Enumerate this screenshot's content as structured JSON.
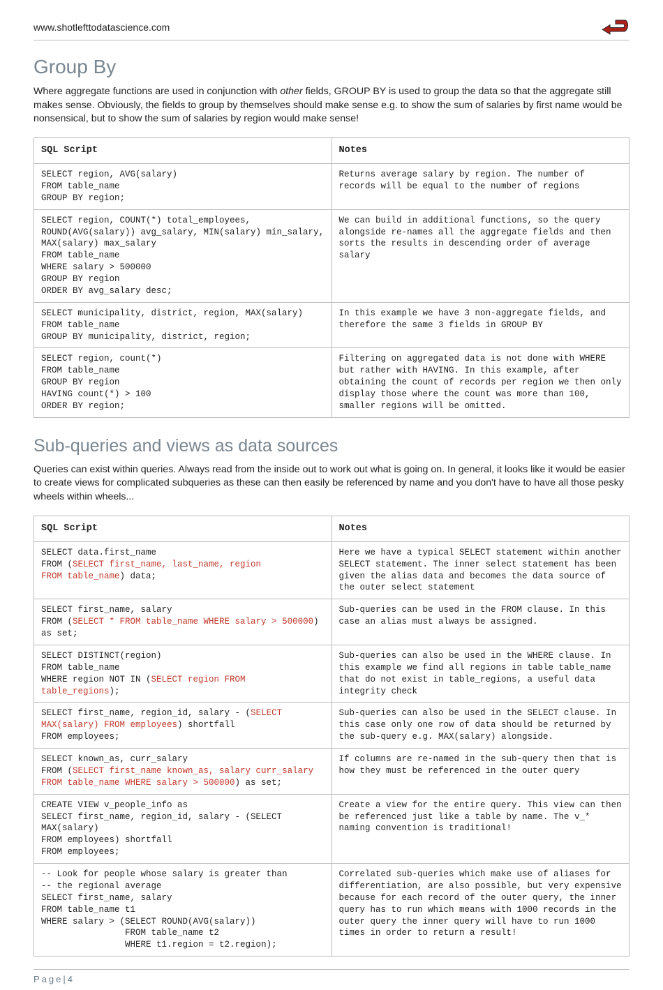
{
  "header": {
    "url": "www.shotlefttodatascience.com"
  },
  "section1": {
    "title": "Group By",
    "intro_pre": "Where aggregate functions are used in conjunction with ",
    "intro_em": "other",
    "intro_post": " fields, GROUP BY is used to group the data so that the aggregate still makes sense. Obviously, the fields to group by themselves should make sense e.g. to show the sum of salaries by first name would be nonsensical, but to show the sum of salaries by region would make sense!",
    "th1": "SQL Script",
    "th2": "Notes",
    "rows": [
      {
        "script": "SELECT region, AVG(salary)\nFROM table_name\nGROUP BY region;",
        "notes": "Returns average salary by region. The number of records will be equal to the number of regions"
      },
      {
        "script": "SELECT region, COUNT(*) total_employees, ROUND(AVG(salary)) avg_salary, MIN(salary) min_salary, MAX(salary) max_salary\nFROM table_name\nWHERE salary > 500000\nGROUP BY region\nORDER BY avg_salary desc;",
        "notes": "We can build in additional functions, so the query alongside re-names all the aggregate fields and then sorts the results in descending order of average salary"
      },
      {
        "script": "SELECT municipality, district, region, MAX(salary)\nFROM table_name\nGROUP BY municipality, district, region;",
        "notes": "In this example we have 3 non-aggregate fields, and therefore the same 3 fields in GROUP BY"
      },
      {
        "script": "SELECT region, count(*)\nFROM table_name\nGROUP BY region\nHAVING count(*) > 100\nORDER BY region;",
        "notes": "Filtering on aggregated data is not done with WHERE but rather with HAVING. In this example, after obtaining the count of records per region we then only display those where the count was more than 100, smaller regions will be omitted."
      }
    ]
  },
  "section2": {
    "title": "Sub-queries and views as data sources",
    "intro": "Queries can exist within queries. Always read from the inside out to work out what is going on. In general, it looks like it would be easier to create views for complicated subqueries as these can then easily be referenced by name and you don't have to have all those pesky wheels within wheels...",
    "th1": "SQL Script",
    "th2": "Notes",
    "rows": [
      {
        "script_parts": [
          {
            "t": "SELECT data.first_name\nFROM ("
          },
          {
            "t": "SELECT first_name, last_name, region\nFROM table_name",
            "red": true
          },
          {
            "t": ") data;"
          }
        ],
        "notes": "Here we have a typical SELECT statement within another SELECT statement. The inner select statement has been given the alias data and becomes the data source of the outer select statement"
      },
      {
        "script_parts": [
          {
            "t": "SELECT first_name, salary\nFROM ("
          },
          {
            "t": "SELECT * FROM table_name WHERE salary > 500000",
            "red": true
          },
          {
            "t": ") as set;"
          }
        ],
        "notes": "Sub-queries can be used in the FROM clause. In this case an alias must always be assigned."
      },
      {
        "script_parts": [
          {
            "t": "SELECT DISTINCT(region)\nFROM table_name\nWHERE region NOT IN ("
          },
          {
            "t": "SELECT region FROM table_regions",
            "red": true
          },
          {
            "t": ");"
          }
        ],
        "notes": "Sub-queries can also be used in the WHERE clause. In this example we find all regions in table table_name that do not exist in table_regions, a useful data integrity check"
      },
      {
        "script_parts": [
          {
            "t": "SELECT first_name, region_id, salary - ("
          },
          {
            "t": "SELECT MAX(salary) FROM employees",
            "red": true
          },
          {
            "t": ") shortfall\nFROM employees;"
          }
        ],
        "notes": "Sub-queries can also be used in the SELECT clause. In this case only one row of data should be returned by the sub-query e.g. MAX(salary) alongside."
      },
      {
        "script_parts": [
          {
            "t": "SELECT known_as, curr_salary\nFROM ("
          },
          {
            "t": "SELECT first_name known_as, salary curr_salary FROM table_name WHERE salary > 500000",
            "red": true
          },
          {
            "t": ") as set;"
          }
        ],
        "notes": "If columns are re-named in the sub-query then that is how they must be referenced in the outer query"
      },
      {
        "script_parts": [
          {
            "t": "CREATE VIEW v_people_info as\nSELECT first_name, region_id, salary - (SELECT MAX(salary)\nFROM employees) shortfall\nFROM employees;"
          }
        ],
        "notes": "Create a view for the entire query. This view can then be referenced just like a table by name. The v_* naming convention is traditional!"
      },
      {
        "script_parts": [
          {
            "t": "-- Look for people whose salary is greater than\n-- the regional average\nSELECT first_name, salary\nFROM table_name t1\nWHERE salary > (SELECT ROUND(AVG(salary))\n                FROM table_name t2\n                WHERE t1.region = t2.region);"
          }
        ],
        "notes": "Correlated sub-queries which make use of aliases for differentiation, are also possible, but very expensive because for each record of the outer query, the inner query has to run which means with 1000 records in the outer query the inner query will have to run 1000 times in order to return a result!"
      }
    ]
  },
  "footer": {
    "label": "Page|",
    "num": "4"
  }
}
